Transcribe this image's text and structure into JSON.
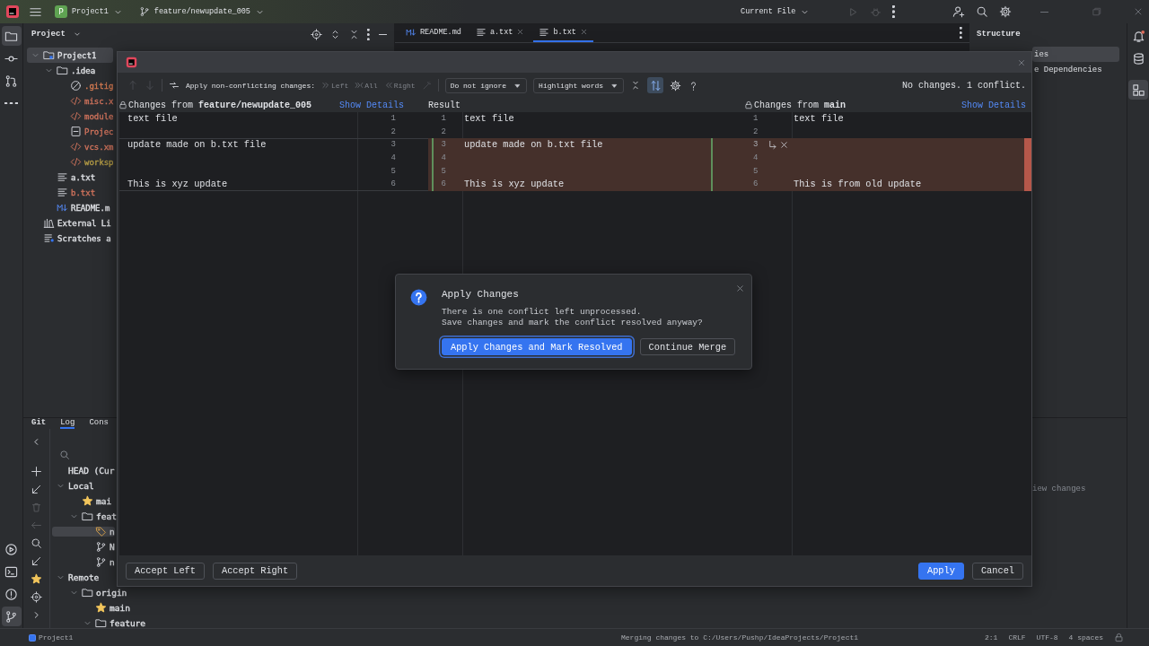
{
  "title_bar": {
    "project_badge": "P",
    "project": "Project1",
    "branch": "feature/newupdate_005",
    "run_config": "Current File"
  },
  "left_toolbar": {
    "top": [
      {
        "kind": "folder",
        "selected": true
      },
      {
        "kind": "commit",
        "selected": false
      },
      {
        "kind": "pull",
        "selected": false
      },
      {
        "kind": "more",
        "selected": false
      }
    ],
    "bottom": [
      {
        "kind": "run",
        "selected": false
      },
      {
        "kind": "terminal",
        "selected": false
      },
      {
        "kind": "problems",
        "selected": false
      },
      {
        "kind": "git",
        "selected": true
      }
    ]
  },
  "right_toolbar": [
    {
      "kind": "bell",
      "selected": false
    },
    {
      "kind": "database",
      "selected": false
    },
    {
      "kind": "structure",
      "selected": true
    }
  ],
  "project_panel": {
    "title": "Project",
    "tree": [
      {
        "label": "Project1",
        "kind": "module",
        "expanded": true,
        "selected": true,
        "children": [
          {
            "label": ".idea",
            "kind": "folder",
            "expanded": true,
            "selected": false,
            "children": [
              {
                "label": ".gitig",
                "kind": "ignore",
                "color": "#d67b52",
                "selected": false
              },
              {
                "label": "misc.x",
                "kind": "xml",
                "color": "#d0735c",
                "selected": false
              },
              {
                "label": "module",
                "kind": "xml",
                "color": "#d0735c",
                "selected": false
              },
              {
                "label": "Projec",
                "kind": "file",
                "color": "#d0735c",
                "selected": false
              },
              {
                "label": "vcs.xm",
                "kind": "xml",
                "color": "#d0735c",
                "selected": false
              },
              {
                "label": "worksp",
                "kind": "xml",
                "color": "#b29a45",
                "selected": false
              }
            ]
          },
          {
            "label": "a.txt",
            "kind": "text",
            "color": "#dfe1e5",
            "selected": false
          },
          {
            "label": "b.txt",
            "kind": "text",
            "color": "#d0735c",
            "selected": false
          },
          {
            "label": "README.m",
            "kind": "markdown",
            "color": "#dfe1e5",
            "selected": false
          }
        ]
      },
      {
        "label": "External Li",
        "kind": "library",
        "selected": false
      },
      {
        "label": "Scratches a",
        "kind": "scratch",
        "selected": false
      }
    ]
  },
  "editor_tabs": [
    {
      "label": "README.md",
      "kind": "markdown",
      "selected": false,
      "closable": false
    },
    {
      "label": "a.txt",
      "kind": "text",
      "selected": false,
      "closable": true
    },
    {
      "label": "b.txt",
      "kind": "text",
      "selected": true,
      "closable": true
    }
  ],
  "structure_panel": {
    "title": "Structure",
    "items": [
      {
        "label": "ies",
        "selected": true
      },
      {
        "label": "e Dependencies",
        "selected": false
      }
    ]
  },
  "git_panel": {
    "title": "Git",
    "tabs": [
      {
        "label": "Log",
        "selected": true
      },
      {
        "label": "Cons",
        "selected": false
      }
    ],
    "tree": [
      {
        "label": "HEAD (Cur",
        "selected": false
      },
      {
        "label": "Local",
        "expanded": true,
        "selected": false,
        "children": [
          {
            "label": "mai",
            "kind": "favorite",
            "selected": false
          },
          {
            "label": "feat",
            "kind": "folder",
            "expanded": true,
            "selected": false,
            "children": [
              {
                "label": "n",
                "kind": "tag",
                "selected": true
              },
              {
                "label": "N",
                "kind": "branch",
                "selected": false
              },
              {
                "label": "n",
                "kind": "branch",
                "selected": false
              }
            ]
          }
        ]
      },
      {
        "label": "Remote",
        "expanded": true,
        "selected": false,
        "children": [
          {
            "label": "origin",
            "kind": "folder",
            "expanded": true,
            "selected": false,
            "children": [
              {
                "label": "main",
                "kind": "favorite",
                "selected": false
              },
              {
                "label": "feature",
                "kind": "folder",
                "expanded": true,
                "selected": false
              }
            ]
          }
        ]
      }
    ],
    "details_text": "iew changes"
  },
  "status_bar": {
    "project": "Project1",
    "message": "Merging changes to C:/Users/Pushp/IdeaProjects/Project1",
    "position": "2:1",
    "line_separator": "CRLF",
    "encoding": "UTF-8",
    "indent": "4 spaces"
  },
  "merge_dialog": {
    "toolbar": {
      "apply_label": "Apply non-conflicting changes:",
      "actions": [
        {
          "label": "Left",
          "kind": "left",
          "disabled": true
        },
        {
          "label": "All",
          "kind": "all",
          "disabled": true
        },
        {
          "label": "Right",
          "kind": "right",
          "disabled": true
        }
      ],
      "ignore_dropdown": "Do not ignore",
      "highlight_dropdown": "Highlight words",
      "sync_scroll": true,
      "status": "No changes. 1 conflict."
    },
    "panes": [
      {
        "kind": "left",
        "title": "Changes from **feature/newupdate_005**",
        "link": "Show Details"
      },
      {
        "kind": "result",
        "title": "Result"
      },
      {
        "kind": "right",
        "title": "Changes from **main**",
        "link": "Show Details"
      }
    ],
    "rows": [
      {
        "left_no": "1",
        "result_no": "1",
        "right_no": "1",
        "left": "text file",
        "result": "text file",
        "right": "text file",
        "conflict": false
      },
      {
        "left_no": "2",
        "result_no": "2",
        "right_no": "2",
        "conflict": false
      },
      {
        "left_no": "3",
        "result_no": "3",
        "right_no": "3",
        "left": "update made on b.txt file",
        "result": "update made on b.txt file",
        "conflict": true
      },
      {
        "left_no": "4",
        "result_no": "4",
        "right_no": "4",
        "conflict": true
      },
      {
        "left_no": "5",
        "result_no": "5",
        "right_no": "5",
        "conflict": true
      },
      {
        "left_no": "6",
        "result_no": "6",
        "right_no": "6",
        "left": "This is xyz update",
        "result": "This is xyz update",
        "right": "This is from old update",
        "conflict": true
      }
    ],
    "buttons_left": [
      {
        "label": "Accept Left",
        "kind": "secondary"
      },
      {
        "label": "Accept Right",
        "kind": "secondary"
      }
    ],
    "buttons_right": [
      {
        "label": "Apply",
        "kind": "primary"
      },
      {
        "label": "Cancel",
        "kind": "secondary"
      }
    ]
  },
  "confirm_dialog": {
    "title": "Apply Changes",
    "message": [
      "There is one conflict left unprocessed.",
      "Save changes and mark the conflict resolved anyway?"
    ],
    "buttons": [
      {
        "label": "Apply Changes and Mark Resolved",
        "kind": "primary"
      },
      {
        "label": "Continue Merge",
        "kind": "secondary"
      }
    ]
  }
}
